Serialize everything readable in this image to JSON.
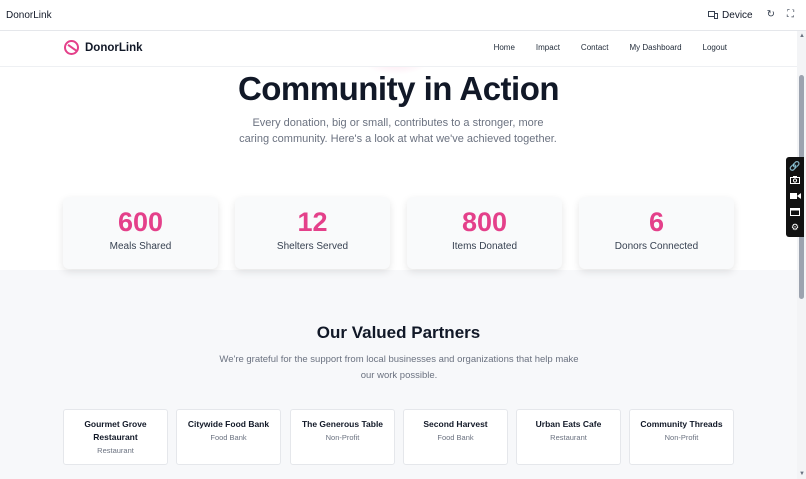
{
  "topbar": {
    "app_title": "DonorLink",
    "device_label": "Device",
    "icons": [
      "device-icon",
      "refresh-icon",
      "fullscreen-icon"
    ]
  },
  "nav": {
    "brand": "DonorLink",
    "links": [
      "Home",
      "Impact",
      "Contact",
      "My Dashboard",
      "Logout"
    ]
  },
  "hero": {
    "title": "Community in Action",
    "subtitle": "Every donation, big or small, contributes to a stronger, more caring community. Here's a look at what we've achieved together."
  },
  "stats": [
    {
      "value": "600",
      "label": "Meals Shared"
    },
    {
      "value": "12",
      "label": "Shelters Served"
    },
    {
      "value": "800",
      "label": "Items Donated"
    },
    {
      "value": "6",
      "label": "Donors Connected"
    }
  ],
  "partners": {
    "title": "Our Valued Partners",
    "subtitle": "We're grateful for the support from local businesses and organizations that help make our work possible.",
    "items": [
      {
        "name": "Gourmet Grove Restaurant",
        "type": "Restaurant"
      },
      {
        "name": "Citywide Food Bank",
        "type": "Food Bank"
      },
      {
        "name": "The Generous Table",
        "type": "Non-Profit"
      },
      {
        "name": "Second Harvest",
        "type": "Food Bank"
      },
      {
        "name": "Urban Eats Cafe",
        "type": "Restaurant"
      },
      {
        "name": "Community Threads",
        "type": "Non-Profit"
      }
    ]
  },
  "tools": [
    "pin-icon",
    "camera-icon",
    "video-icon",
    "window-icon",
    "settings-icon"
  ],
  "colors": {
    "accent": "#e4408a",
    "heading": "#111827",
    "muted": "#6b7280",
    "section_bg": "#f7f8fa"
  }
}
